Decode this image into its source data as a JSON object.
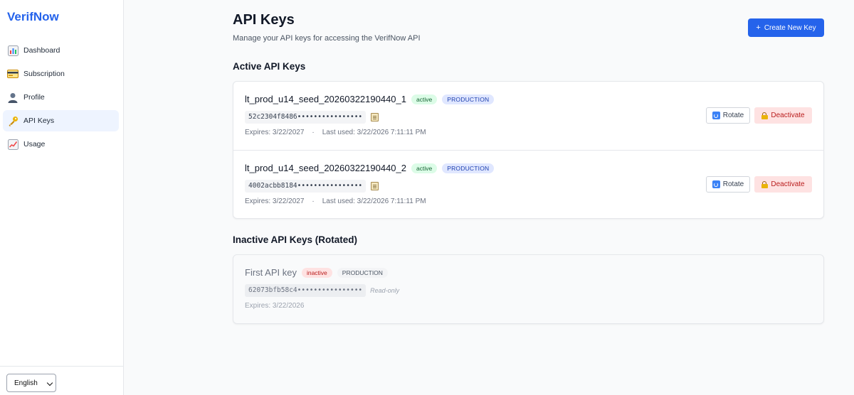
{
  "sidebar": {
    "brand": "VerifNow",
    "items": [
      {
        "label": "Dashboard",
        "icon": "bar-chart-icon"
      },
      {
        "label": "Subscription",
        "icon": "credit-card-icon"
      },
      {
        "label": "Profile",
        "icon": "user-icon"
      },
      {
        "label": "API Keys",
        "icon": "key-icon",
        "active": true
      },
      {
        "label": "Usage",
        "icon": "line-chart-icon"
      }
    ],
    "language": "English"
  },
  "header": {
    "title": "API Keys",
    "subtitle": "Manage your API keys for accessing the VerifNow API",
    "create_button": "Create New Key",
    "create_icon": "+"
  },
  "active_section": {
    "title": "Active API Keys",
    "keys": [
      {
        "name": "lt_prod_u14_seed_20260322190440_1",
        "status": "active",
        "environment": "PRODUCTION",
        "masked_key": "52c2304f8486••••••••••••••••",
        "expires": "Expires: 3/22/2027",
        "last_used": "Last used: 3/22/2026 7:11:11 PM",
        "rotate_label": "Rotate",
        "deactivate_label": "Deactivate"
      },
      {
        "name": "lt_prod_u14_seed_20260322190440_2",
        "status": "active",
        "environment": "PRODUCTION",
        "masked_key": "4002acbb8184••••••••••••••••",
        "expires": "Expires: 3/22/2027",
        "last_used": "Last used: 3/22/2026 7:11:11 PM",
        "rotate_label": "Rotate",
        "deactivate_label": "Deactivate"
      }
    ]
  },
  "inactive_section": {
    "title": "Inactive API Keys (Rotated)",
    "keys": [
      {
        "name": "First API key",
        "status": "inactive",
        "environment": "PRODUCTION",
        "masked_key": "62073bfb58c4••••••••••••••••",
        "read_only": "Read-only",
        "expires": "Expires: 3/22/2026"
      }
    ]
  },
  "meta_separator": "·",
  "colors": {
    "brand": "#2563eb",
    "active_badge": "#dcfce7",
    "production_badge": "#e0e7ff",
    "inactive_badge": "#fee2e2",
    "danger": "#b91c1c"
  }
}
